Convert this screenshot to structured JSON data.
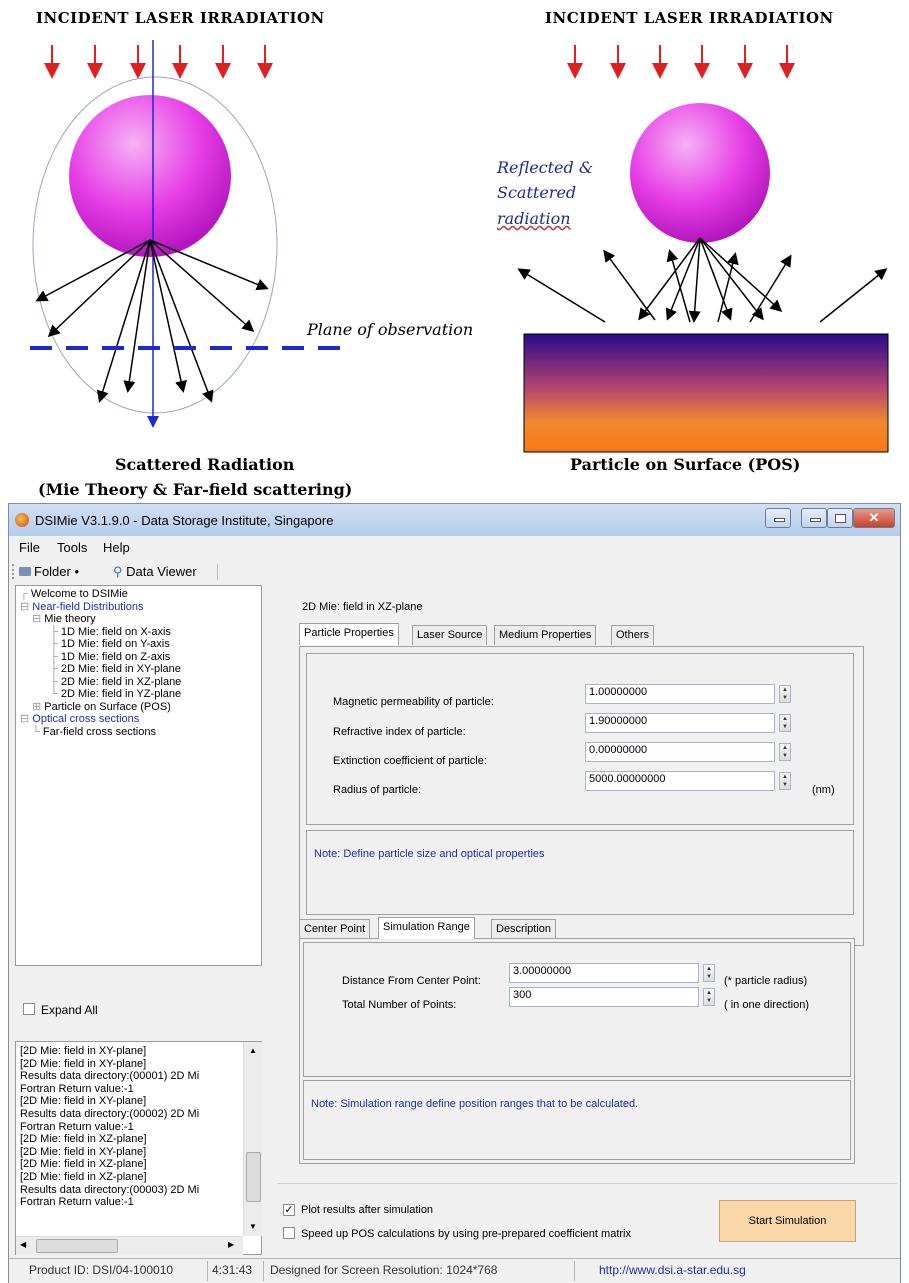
{
  "diagram": {
    "left_title": "INCIDENT LASER IRRADIATION",
    "right_title": "INCIDENT LASER IRRADIATION",
    "plane_label": "Plane of observation",
    "reflected_line1": "Reflected &",
    "reflected_line2": "Scattered",
    "reflected_line3": "radiation",
    "left_caption_1": "Scattered Radiation",
    "left_caption_2": "(Mie Theory & Far-field scattering)",
    "right_caption": "Particle on Surface (POS)"
  },
  "window": {
    "title": "DSIMie V3.1.9.0 -  Data Storage Institute, Singapore",
    "menu": [
      "File",
      "Tools",
      "Help"
    ],
    "toolbar": {
      "folder": "Folder •",
      "data_viewer": "Data Viewer"
    }
  },
  "tree": {
    "welcome": "Welcome to DSIMie",
    "near_field": "Near-field Distributions",
    "mie_theory": "Mie theory",
    "items": [
      "1D Mie: field on X-axis",
      "1D Mie: field on Y-axis",
      "1D Mie: field on Z-axis",
      "2D Mie: field in XY-plane",
      "2D Mie: field in XZ-plane",
      "2D Mie: field in YZ-plane"
    ],
    "pos": "Particle on Surface (POS)",
    "optical": "Optical  cross sections",
    "far_field": "Far-field cross sections"
  },
  "expand_all": "Expand All",
  "log": [
    "[2D Mie: field in XY-plane]",
    "[2D Mie: field in XY-plane]",
    "Results data directory:(00001) 2D Mi",
    "Fortran Return value:-1",
    "[2D Mie: field in XY-plane]",
    "Results data directory:(00002) 2D Mi",
    "Fortran Return value:-1",
    "[2D Mie: field in XZ-plane]",
    "[2D Mie: field in XY-plane]",
    "[2D Mie: field in XZ-plane]",
    "[2D Mie: field in XZ-plane]",
    "Results data directory:(00003) 2D Mi",
    "Fortran Return value:-1"
  ],
  "main": {
    "heading": "2D Mie: field in XZ-plane",
    "tabs1": [
      "Particle Properties",
      "Laser Source",
      "Medium Properties",
      "Others"
    ],
    "fields": [
      {
        "label": "Magnetic permeability of particle:",
        "value": "1.00000000"
      },
      {
        "label": "Refractive index of particle:",
        "value": "1.90000000"
      },
      {
        "label": "Extinction coefficient of particle:",
        "value": "0.00000000"
      },
      {
        "label": "Radius of particle:",
        "value": "5000.00000000"
      }
    ],
    "unit_nm": "(nm)",
    "note1": "Note: Define particle size and optical properties",
    "tabs2": [
      "Center Point",
      "Simulation Range",
      "Description"
    ],
    "range_fields": [
      {
        "label": "Distance From Center Point:",
        "value": "3.00000000",
        "unit": "(* particle radius)"
      },
      {
        "label": "Total Number of Points:",
        "value": "300",
        "unit": "( in one direction)"
      }
    ],
    "note2": "Note: Simulation range define position ranges that to be calculated.",
    "plot_results": "Plot results after simulation",
    "speed_up": "Speed up POS calculations by using pre-prepared coefficient matrix",
    "start": "Start Simulation"
  },
  "status": {
    "product": "Product ID:  DSI/04-100010",
    "time": "4:31:43",
    "resolution": "Designed for Screen Resolution: 1024*768",
    "url": "http://www.dsi.a-star.edu.sg"
  },
  "colors": {
    "link_blue": "#1c2fa8",
    "sphere": "#e040e0",
    "arrow_red": "#e02020"
  }
}
